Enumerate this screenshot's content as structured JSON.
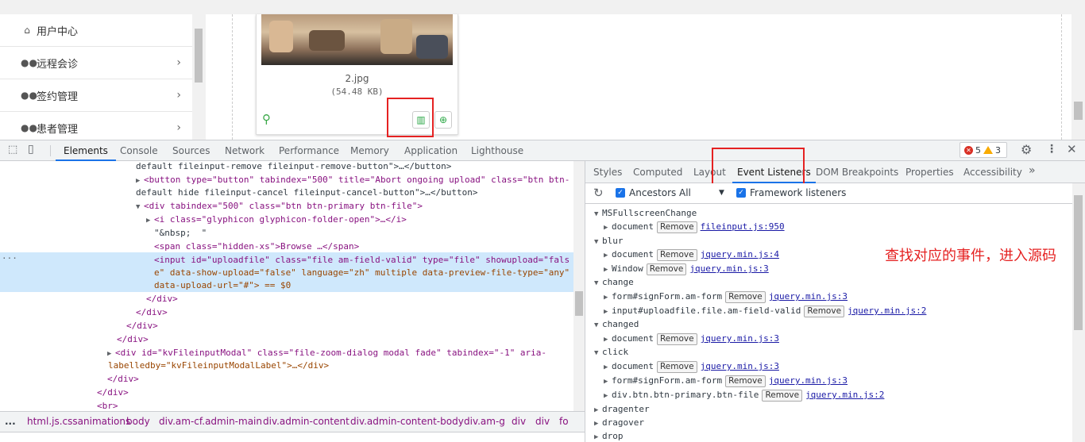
{
  "left_nav": {
    "items": [
      {
        "icon": "home-icon",
        "label": "用户中心",
        "chevron": false
      },
      {
        "icon": "users-icon",
        "label": "远程会诊",
        "chevron": true
      },
      {
        "icon": "users-icon",
        "label": "签约管理",
        "chevron": true
      },
      {
        "icon": "users-icon",
        "label": "患者管理",
        "chevron": true
      }
    ]
  },
  "preview": {
    "file_name": "2.jpg",
    "file_size": "(54.48 KB)",
    "delete_icon": "trash-icon",
    "zoom_icon": "zoom-in-icon",
    "drag_icon": "drag-handle-icon"
  },
  "devtools": {
    "tabs": [
      "Elements",
      "Console",
      "Sources",
      "Network",
      "Performance",
      "Memory",
      "Application",
      "Lighthouse"
    ],
    "active_tab": "Elements",
    "errors": "5",
    "warnings": "3",
    "code_lines": [
      "default fileinput-remove fileinput-remove-button\">…</button>",
      "<button type=\"button\" tabindex=\"500\" title=\"Abort ongoing upload\" class=\"btn btn-",
      "default hide fileinput-cancel fileinput-cancel-button\">…</button>",
      "<div tabindex=\"500\" class=\"btn btn-primary btn-file\">",
      "<i class=\"glyphicon glyphicon-folder-open\">…</i>",
      "\"&nbsp;  \"",
      "<span class=\"hidden-xs\">Browse …</span>",
      "<input id=\"uploadfile\" class=\"file am-field-valid\" type=\"file\" showupload=\"fals",
      "e\" data-show-upload=\"false\" language=\"zh\" multiple data-preview-file-type=\"any\"",
      "data-upload-url=\"#\"> == $0",
      "</div>",
      "</div>",
      "</div>",
      "</div>",
      "<div id=\"kvFileinputModal\" class=\"file-zoom-dialog modal fade\" tabindex=\"-1\" aria-",
      "labelledby=\"kvFileinputModalLabel\">…</div>",
      "</div>",
      "</div>",
      "<br>"
    ],
    "breadcrumb": [
      "...",
      "html.js.cssanimations",
      "body",
      "div.am-cf.admin-main",
      "div.admin-content",
      "div.admin-content-body",
      "div.am-g",
      "div",
      "div",
      "fo"
    ],
    "side_tabs": [
      "Styles",
      "Computed",
      "Layout",
      "Event Listeners",
      "DOM Breakpoints",
      "Properties",
      "Accessibility"
    ],
    "active_side_tab": "Event Listeners",
    "ancestors_label": "Ancestors",
    "ancestors_select": "All",
    "framework_label": "Framework listeners",
    "remove_label": "Remove",
    "events": [
      {
        "name": "MSFullscreenChange",
        "items": [
          {
            "target": "document",
            "link": "fileinput.js:950"
          }
        ]
      },
      {
        "name": "blur",
        "items": [
          {
            "target": "document",
            "link": "jquery.min.js:4"
          },
          {
            "target": "Window",
            "link": "jquery.min.js:3"
          }
        ]
      },
      {
        "name": "change",
        "items": [
          {
            "target": "form#signForm.am-form",
            "link": "jquery.min.js:3"
          },
          {
            "target": "input#uploadfile.file.am-field-valid",
            "link": "jquery.min.js:2"
          }
        ]
      },
      {
        "name": "changed",
        "items": [
          {
            "target": "document",
            "link": "jquery.min.js:3"
          }
        ]
      },
      {
        "name": "click",
        "items": [
          {
            "target": "document",
            "link": "jquery.min.js:3"
          },
          {
            "target": "form#signForm.am-form",
            "link": "jquery.min.js:3"
          },
          {
            "target": "div.btn.btn-primary.btn-file",
            "link": "jquery.min.js:2"
          }
        ]
      },
      {
        "name": "dragenter",
        "items": []
      },
      {
        "name": "dragover",
        "items": []
      },
      {
        "name": "drop",
        "items": []
      }
    ],
    "annotation": "查找对应的事件，进入源码"
  },
  "colors": {
    "accent": "#1a73e8",
    "annotation": "#e52222",
    "tag": "#881280",
    "attr_name": "#994500",
    "attr_value": "#1a1aa6"
  }
}
